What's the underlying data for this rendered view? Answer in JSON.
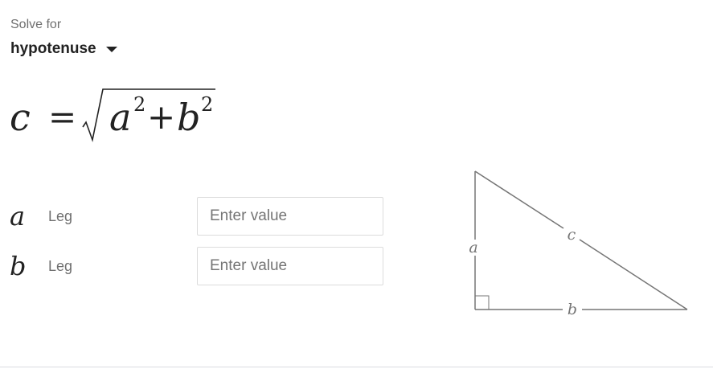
{
  "solver": {
    "label": "Solve for",
    "selected": "hypotenuse"
  },
  "formula": {
    "lhs": "c",
    "equals": "=",
    "term1": "a",
    "exp1": "2",
    "plus": "+",
    "term2": "b",
    "exp2": "2"
  },
  "variables": [
    {
      "symbol": "a",
      "description": "Leg",
      "placeholder": "Enter value",
      "value": ""
    },
    {
      "symbol": "b",
      "description": "Leg",
      "placeholder": "Enter value",
      "value": ""
    }
  ],
  "diagram": {
    "side_a": "a",
    "side_b": "b",
    "side_c": "c"
  },
  "colors": {
    "diagram_stroke": "#757575",
    "input_border": "#dcdcdc"
  }
}
